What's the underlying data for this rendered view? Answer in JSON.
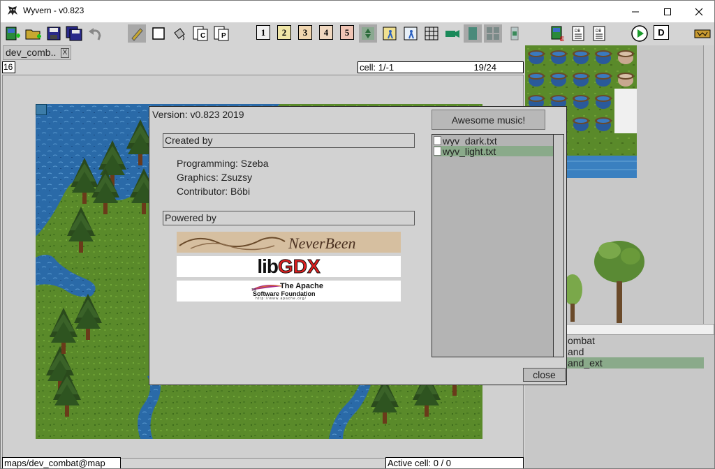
{
  "window": {
    "title": "Wyvern - v0.823"
  },
  "toolbar": {
    "layer_buttons": [
      "1",
      "2",
      "3",
      "4",
      "5"
    ],
    "d_button": "D",
    "colors": {
      "layer1": "#f0f0f0",
      "layer2": "#f0e6a8",
      "layer3": "#f0d6b0",
      "layer4": "#f0d8c0",
      "layer5": "#f0c4b4"
    }
  },
  "map_panel": {
    "tab_label": "dev_comb..",
    "tab_close": "X",
    "zoom": "16",
    "cell_label": "cell: 1/-1",
    "cell_count": "19/24",
    "status_path": "maps/dev_combat@map",
    "status_active": "Active cell: 0 / 0"
  },
  "tileset_list": {
    "items": [
      "ombat",
      "and",
      "and_ext"
    ],
    "selected_index": 2
  },
  "about_dialog": {
    "version": "Version: v0.823 2019",
    "created_by_label": "Created by",
    "credits": [
      "Programming: Szeba",
      "Graphics: Zsuzsy",
      "Contributor: Böbi"
    ],
    "powered_by_label": "Powered by",
    "logos": {
      "neverbeen": "NeverBeen",
      "libgdx_a": "lib",
      "libgdx_b": "GDX",
      "apache_line1": "The Apache",
      "apache_line2": "Software Foundation",
      "apache_url": "http://www.apache.org/",
      "apache_tm": "TM"
    },
    "music_button": "Awesome music!",
    "music_files": [
      "wyv_dark.txt",
      "wyv_light.txt"
    ],
    "music_selected_index": 1,
    "close_button": "close"
  },
  "icons": [
    "app-icon",
    "minimize-icon",
    "maximize-icon",
    "close-icon",
    "new-map-icon",
    "open-folder-icon",
    "save-icon",
    "save-all-icon",
    "undo-icon",
    "pencil-icon",
    "eraser-icon",
    "fill-icon",
    "copy-icon",
    "paste-icon",
    "events-icon",
    "collision-icon",
    "grid-icon",
    "camera-icon",
    "play-icon"
  ]
}
